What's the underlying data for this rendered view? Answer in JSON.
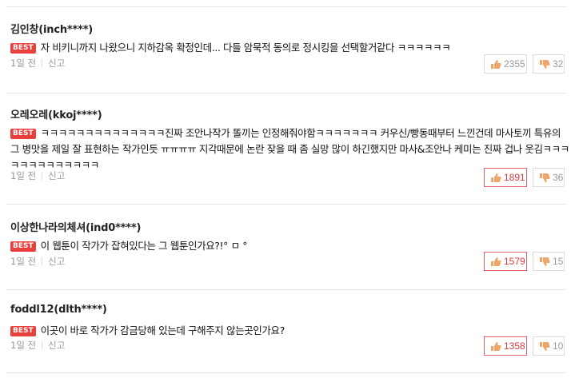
{
  "badge_label": "BEST",
  "report_label": "신고",
  "comments": [
    {
      "author": "김인창(inch****)",
      "text": "자 비키니까지 나왔으니 지하감옥 확정인데... 다들 암묵적 동의로 정시킹을 선택할거같다 ㅋㅋㅋㅋㅋㅋ",
      "time": "1일 전",
      "likes": "2355",
      "dislikes": "32",
      "likes_highlighted": false
    },
    {
      "author": "오레오레(kkoj****)",
      "text": "ㅋㅋㅋㅋㅋㅋㅋㅋㅋㅋㅋㅋㅋㅋ진짜 조안나작가 똘끼는 인정해줘야함ㅋㅋㅋㅋㅋㅋㅋ 커우신/빵동때부터 느낀건데 마사토끼 특유의 그 병맛을 제일 잘 표현하는 작가인듯 ㅠㅠㅠㅠ 지각때문에 논란 잦을 때 좀 실망 많이 하긴했지만 마사&조안나 케미는 진짜 겁나 웃김ㅋㅋㅋㅋㅋㅋㅋㅋㅋㅋㅋㅋㅋ",
      "time": "1일 전",
      "likes": "1891",
      "dislikes": "36",
      "likes_highlighted": true
    },
    {
      "author": "이상한나라의체셔(ind0****)",
      "text": "이 웹툰이 작가가 잡혀있다는 그 웹툰인가요?!° ㅁ °",
      "time": "1일 전",
      "likes": "1579",
      "dislikes": "15",
      "likes_highlighted": true
    },
    {
      "author": "foddl12(dlth****)",
      "text": "이곳이 바로 작가가 감금당해 있는데 구해주지 않는곳인가요?",
      "time": "1일 전",
      "likes": "1358",
      "dislikes": "10",
      "likes_highlighted": true
    }
  ],
  "icons": {
    "like": "thumbs-up-icon",
    "dislike": "thumbs-down-icon"
  },
  "colors": {
    "best_badge": "#e8403d",
    "highlight_border": "#e06666",
    "highlight_text": "#d93b3b",
    "like_icon": "#f0a66a",
    "dislike_icon": "#f0a66a"
  }
}
